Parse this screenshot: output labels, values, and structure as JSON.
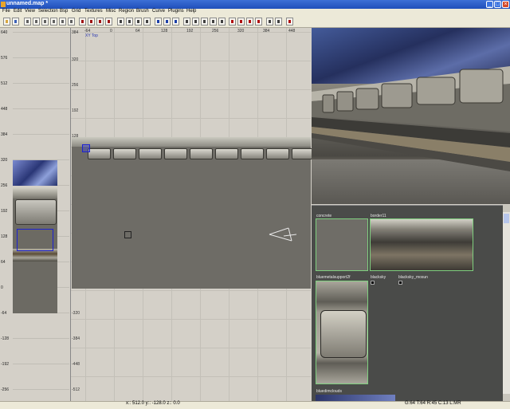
{
  "window": {
    "title": "unnamed.map *",
    "min_label": "_",
    "max_label": "□",
    "close_label": "×"
  },
  "menu": [
    "File",
    "Edit",
    "View",
    "Selection",
    "Bsp",
    "Grid",
    "Textures",
    "Misc",
    "Region",
    "Brush",
    "Curve",
    "Plugins",
    "Help"
  ],
  "toolbar": {
    "tools": [
      {
        "icon": "open-icon",
        "color": "#d6a640"
      },
      {
        "icon": "save-icon",
        "color": "#3d62b8"
      },
      {
        "icon": "flip-x-icon",
        "color": "#606060"
      },
      {
        "icon": "flip-y-icon",
        "color": "#606060"
      },
      {
        "icon": "flip-z-icon",
        "color": "#606060"
      },
      {
        "icon": "rotate-x-icon",
        "color": "#606060"
      },
      {
        "icon": "rotate-y-icon",
        "color": "#606060"
      },
      {
        "icon": "rotate-z-icon",
        "color": "#606060"
      },
      {
        "icon": "select-complete-icon",
        "color": "#a01515"
      },
      {
        "icon": "select-touching-icon",
        "color": "#a01515"
      },
      {
        "icon": "select-partial-icon",
        "color": "#a01515"
      },
      {
        "icon": "select-inside-icon",
        "color": "#a01515"
      },
      {
        "icon": "csg-subtract-icon",
        "color": "#404040"
      },
      {
        "icon": "csg-merge-icon",
        "color": "#404040"
      },
      {
        "icon": "make-hollow-icon",
        "color": "#404040"
      },
      {
        "icon": "clipper-icon",
        "color": "#404040"
      },
      {
        "icon": "change-view-icon",
        "color": "#1c3fa8"
      },
      {
        "icon": "texture-view-icon",
        "color": "#1c3fa8"
      },
      {
        "icon": "cubic-clip-icon",
        "color": "#1c3fa8"
      },
      {
        "icon": "camera-move-icon",
        "color": "#404040"
      },
      {
        "icon": "texture-lock-icon",
        "color": "#404040"
      },
      {
        "icon": "vertex-edit-icon",
        "color": "#404040"
      },
      {
        "icon": "edge-edit-icon",
        "color": "#404040"
      },
      {
        "icon": "face-edit-icon",
        "color": "#404040"
      },
      {
        "icon": "patch-bevel-icon",
        "color": "#b01010"
      },
      {
        "icon": "patch-endcap-icon",
        "color": "#b01010"
      },
      {
        "icon": "patch-cone-icon",
        "color": "#b01010"
      },
      {
        "icon": "patch-drill-icon",
        "color": "#b01010"
      },
      {
        "icon": "show-entities-icon",
        "color": "#404040"
      },
      {
        "icon": "show-paths-icon",
        "color": "#404040"
      },
      {
        "icon": "plugin-icon",
        "color": "#b01010"
      }
    ]
  },
  "side_view": {
    "ticks": [
      "640",
      "576",
      "512",
      "448",
      "384",
      "320",
      "256",
      "192",
      "128",
      "64",
      "0",
      "-64",
      "-128",
      "-192",
      "-256"
    ]
  },
  "xy_view": {
    "label": "XY Top",
    "ruler_ticks": [
      "-64",
      "0",
      "64",
      "128",
      "192",
      "256",
      "320",
      "384",
      "448"
    ],
    "y_ticks": [
      "384",
      "320",
      "256",
      "192",
      "128",
      "-320",
      "-384",
      "-448",
      "-512"
    ]
  },
  "texture_browser": {
    "textures": [
      {
        "name": "concrete"
      },
      {
        "name": "border11"
      },
      {
        "name": "bluemetalsupport2f"
      },
      {
        "name": "blacksky"
      },
      {
        "name": "blacksky_mosun"
      },
      {
        "name": "bluedimclouds"
      }
    ]
  },
  "status": {
    "coords": "x:: 512.0  y:: -128.0  z:: 0.0",
    "grid": "G:64 T:64 R:45 C:13 L:MR"
  },
  "colors": {
    "titlebar": "#1f4fba",
    "grid_bg": "#d4d0c8",
    "texture_bg": "#4a4b49",
    "selection": "#1d22d1"
  }
}
